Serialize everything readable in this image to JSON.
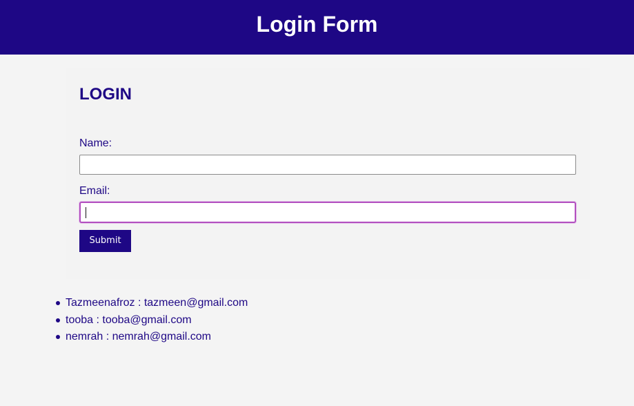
{
  "header": {
    "title": "Login Form"
  },
  "form": {
    "title": "LOGIN",
    "name_label": "Name:",
    "name_value": "",
    "email_label": "Email:",
    "email_value": "",
    "submit_label": "Submit"
  },
  "users": [
    {
      "text": "Tazmeenafroz : tazmeen@gmail.com"
    },
    {
      "text": "tooba : tooba@gmail.com"
    },
    {
      "text": "nemrah : nemrah@gmail.com"
    }
  ],
  "colors": {
    "brand": "#1e0785",
    "background": "#f4f4f4",
    "focus_border": "#b24fbf"
  }
}
